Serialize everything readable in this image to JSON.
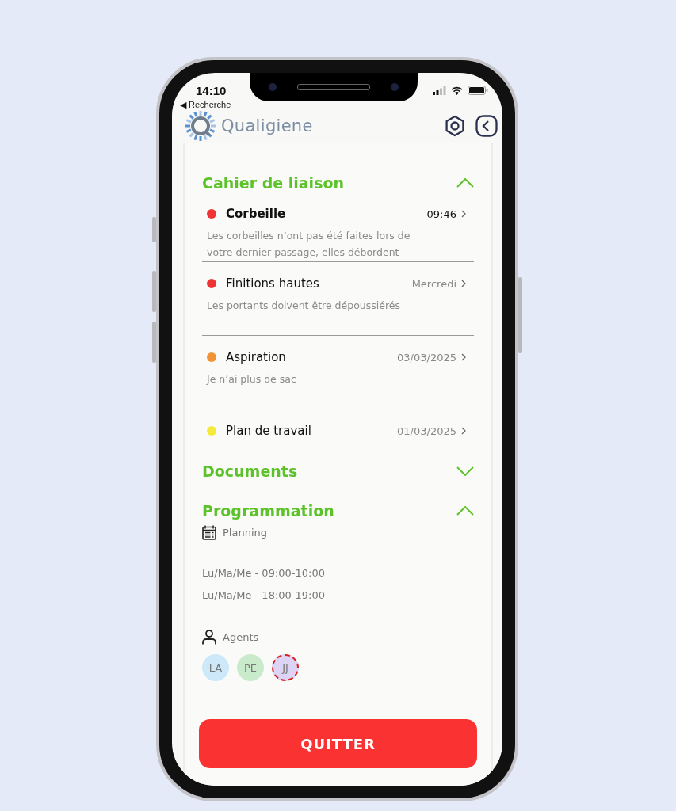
{
  "status_bar": {
    "time": "14:10",
    "back_app": "◀ Recherche"
  },
  "header": {
    "brand": "Qualigiene"
  },
  "sections": [
    {
      "title": "Cahier de liaison",
      "expanded": true,
      "kind": "messages",
      "items": [
        {
          "title": "Corbeille",
          "unread": true,
          "time": "09:46",
          "text": "Les corbeilles n’ont pas été faites lors de votre dernier passage, elles débordent",
          "color": "#f03434"
        },
        {
          "title": "Finitions hautes",
          "unread": false,
          "time": "Mercredi",
          "text": "Les portants doivent être dépoussiérés",
          "color": "#f03434"
        },
        {
          "title": "Aspiration",
          "unread": false,
          "time": "03/03/2025",
          "text": "Je n’ai plus de sac",
          "color": "#f29435"
        },
        {
          "title": "Plan de travail",
          "unread": false,
          "time": "01/03/2025",
          "color": "#f5ea3a"
        }
      ]
    },
    {
      "title": "Documents",
      "expanded": false,
      "kind": "documents"
    },
    {
      "title": "Programmation",
      "expanded": true,
      "kind": "schedule",
      "planning_label": "Planning",
      "slots": [
        "Lu/Ma/Me - 09:00-10:00",
        "Lu/Ma/Me - 18:00-19:00"
      ],
      "agents_label": "Agents",
      "agents": [
        {
          "initials": "LA",
          "color": "#cde8f8",
          "selected": false
        },
        {
          "initials": "PE",
          "color": "#c9ebcb",
          "selected": false
        },
        {
          "initials": "JJ",
          "color": "#ddd3f5",
          "selected": true
        }
      ]
    }
  ],
  "quit_button": "QUITTER"
}
